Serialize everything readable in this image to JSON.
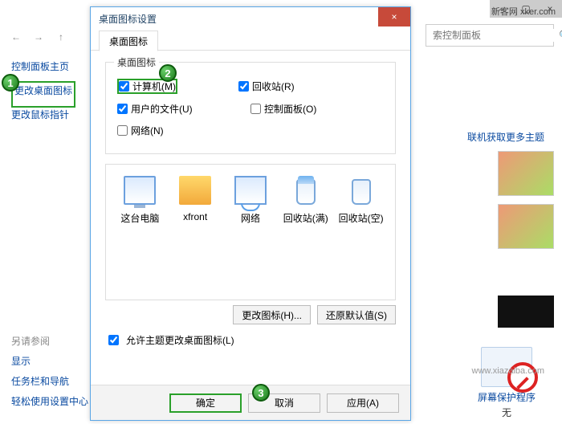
{
  "watermark": "新客网 xker.com",
  "watermark2": "www.xiazaiba.com",
  "window": {
    "close": "×",
    "minimize": "–",
    "maximize": "▢"
  },
  "address": {
    "search_placeholder": "索控制面板"
  },
  "sidebar": {
    "home": "控制面板主页",
    "change_desktop_icons": "更改桌面图标",
    "change_mouse_pointers": "更改鼠标指针",
    "see_also_title": "另请参阅",
    "see_also": {
      "display": "显示",
      "taskbar": "任务栏和导航",
      "ease": "轻松使用设置中心"
    }
  },
  "right": {
    "more_themes": "联机获取更多主题",
    "screensaver_link": "屏幕保护程序",
    "screensaver_none": "无"
  },
  "dialog": {
    "title": "桌面图标设置",
    "tab": "桌面图标",
    "group_title": "桌面图标",
    "checks": {
      "computer": "计算机(M)",
      "recycle_bin": "回收站(R)",
      "user_files": "用户的文件(U)",
      "control_panel": "控制面板(O)",
      "network": "网络(N)"
    },
    "icons": {
      "this_pc": "这台电脑",
      "xfront": "xfront",
      "network": "网络",
      "bin_full": "回收站(满)",
      "bin_empty": "回收站(空)"
    },
    "change_icon": "更改图标(H)...",
    "restore_default": "还原默认值(S)",
    "allow_themes": "允许主题更改桌面图标(L)",
    "ok": "确定",
    "cancel": "取消",
    "apply": "应用(A)"
  },
  "badges": {
    "b1": "1",
    "b2": "2",
    "b3": "3"
  }
}
